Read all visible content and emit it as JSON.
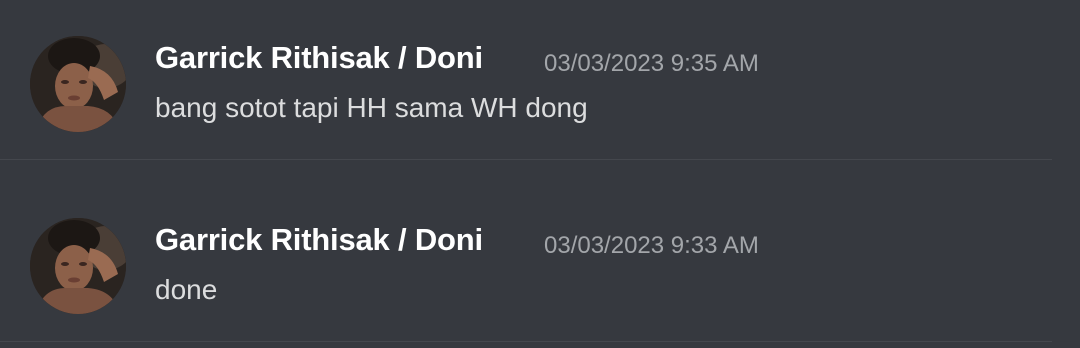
{
  "messages": [
    {
      "author": "Garrick Rithisak / Doni",
      "timestamp": "03/03/2023 9:35 AM",
      "text": "bang sotot tapi HH sama WH dong"
    },
    {
      "author": "Garrick Rithisak / Doni",
      "timestamp": "03/03/2023 9:33 AM",
      "text": "done"
    }
  ],
  "colors": {
    "background": "#36393f",
    "username": "#ffffff",
    "timestamp": "#a3a6aa",
    "message_text": "#dcddde",
    "divider": "#44474d"
  }
}
